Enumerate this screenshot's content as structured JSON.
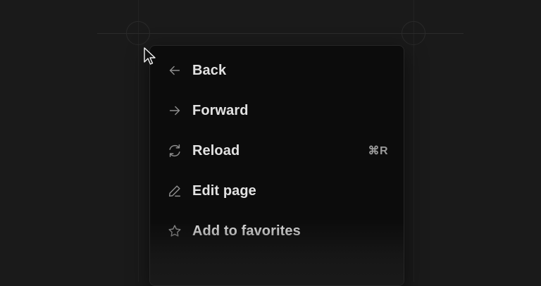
{
  "menu": {
    "items": [
      {
        "label": "Back",
        "icon": "arrow-left-icon",
        "shortcut": ""
      },
      {
        "label": "Forward",
        "icon": "arrow-right-icon",
        "shortcut": ""
      },
      {
        "label": "Reload",
        "icon": "refresh-icon",
        "shortcut": "⌘R"
      },
      {
        "label": "Edit page",
        "icon": "pen-icon",
        "shortcut": ""
      },
      {
        "label": "Add to favorites",
        "icon": "star-icon",
        "shortcut": ""
      }
    ]
  },
  "colors": {
    "background": "#1a1a1a",
    "menu_background": "#0c0c0c",
    "label": "#e2e2e2",
    "icon": "#8e8e8e",
    "shortcut": "#9a9a9a"
  }
}
